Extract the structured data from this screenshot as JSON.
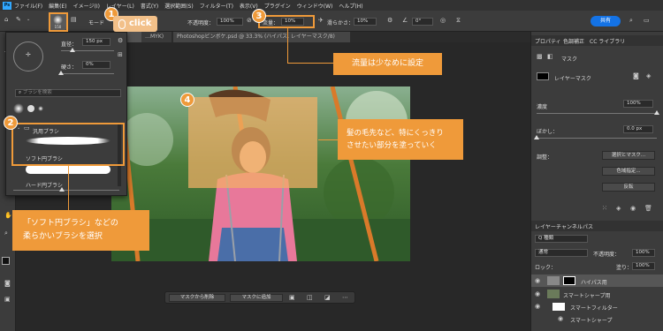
{
  "menubar": {
    "items": [
      "ファイル(F)",
      "編集(E)",
      "イメージ(I)",
      "レイヤー(L)",
      "書式(Y)",
      "選択範囲(S)",
      "フィルター(T)",
      "表示(V)",
      "プラグイン",
      "ウィンドウ(W)",
      "ヘルプ(H)"
    ],
    "ps_icon": "Ps"
  },
  "options": {
    "brush_size": "150",
    "mode_label": "モード",
    "opacity_label": "不透明度：",
    "opacity_value": "100%",
    "flow_label": "流量：",
    "flow_value": "10%",
    "smoothing_label": "滑らかさ：",
    "smoothing_value": "10%",
    "angle_value": "0°",
    "share_label": "共有"
  },
  "tabs": {
    "tab1": "…MYK)",
    "tab2": "Photoshopビンボケ.psd @ 33.3% (ハイパス, レイヤーマスク/8)"
  },
  "brush_panel": {
    "diameter_label": "直径：",
    "diameter_value": "150 px",
    "hardness_label": "硬さ：",
    "hardness_value": "0%",
    "search_placeholder": "ブラシを検索",
    "folder_label": "汎用ブラシ",
    "brush1_label": "ソフト円ブラシ",
    "brush2_label": "ハード円ブラシ"
  },
  "right_panel": {
    "tabs": [
      "プロパティ",
      "色調補正",
      "CC ライブラリ"
    ],
    "mask_title": "マスク",
    "layer_mask_label": "レイヤーマスク",
    "density_label": "濃度",
    "density_value": "100%",
    "feather_label": "ぼかし：",
    "feather_value": "0.0 px",
    "adjust_label": "調整：",
    "select_mask_btn": "選択とマスク...",
    "color_range_btn": "色域指定...",
    "invert_btn": "反転",
    "layers_tabs": [
      "レイヤー",
      "チャンネル",
      "パス"
    ],
    "kind_label": "Q 種類",
    "blend_mode": "通常",
    "opacity_label": "不透明度：",
    "opacity_value": "100%",
    "lock_label": "ロック：",
    "fill_label": "塗り：",
    "fill_value": "100%",
    "layers": [
      "ハイパス用",
      "スマートシャープ用",
      "スマートフィルター",
      "スマートシャープ"
    ]
  },
  "context_bar": {
    "subtract": "マスクから削除",
    "add": "マスクに追加"
  },
  "annotations": {
    "n1": "1",
    "n2": "2",
    "n3": "3",
    "n4": "4",
    "click": "click",
    "callout3": "流量は少なめに設定",
    "callout4_line1": "髪の毛先など、特にくっきり",
    "callout4_line2": "させたい部分を塗っていく",
    "callout2_line1": "「ソフト円ブラシ」などの",
    "callout2_line2": "柔らかいブラシを選択"
  },
  "colors": {
    "accent": "#ef9a3a",
    "ps_blue": "#31a8ff",
    "share": "#1473e6"
  }
}
